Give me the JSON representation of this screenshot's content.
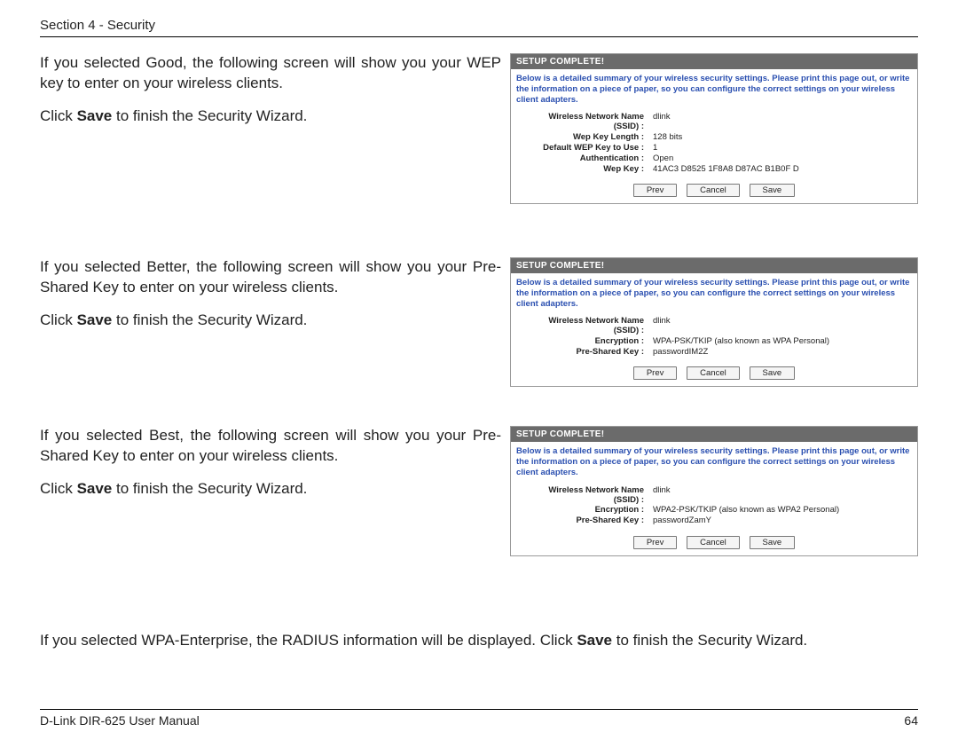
{
  "header": {
    "section_label": "Section 4 - Security"
  },
  "footer": {
    "left": "D-Link DIR-625 User Manual",
    "page": "64"
  },
  "panel_common": {
    "title": "SETUP COMPLETE!",
    "desc": "Below is a detailed summary of your wireless security settings. Please print this page out, or write the information on a piece of paper, so you can configure the correct settings on your wireless client adapters.",
    "btn_prev": "Prev",
    "btn_cancel": "Cancel",
    "btn_save": "Save"
  },
  "good": {
    "p1": "If you selected Good, the following screen will show you your WEP key to enter on your wireless clients.",
    "p2a": "Click ",
    "p2b": "Save",
    "p2c": " to finish the Security Wizard.",
    "fields": {
      "ssid_label": "Wireless Network Name\n(SSID) :",
      "ssid_val": "dlink",
      "len_label": "Wep Key Length :",
      "len_val": "128 bits",
      "idx_label": "Default WEP Key to Use :",
      "idx_val": "1",
      "auth_label": "Authentication :",
      "auth_val": "Open",
      "key_label": "Wep Key :",
      "key_val": "41AC3 D8525 1F8A8 D87AC B1B0F D"
    }
  },
  "better": {
    "p1": "If you selected Better, the following screen will show you your Pre-Shared Key to enter on your wireless clients.",
    "p2a": "Click ",
    "p2b": "Save",
    "p2c": " to finish the Security Wizard.",
    "fields": {
      "ssid_label": "Wireless Network Name\n(SSID) :",
      "ssid_val": "dlink",
      "enc_label": "Encryption :",
      "enc_val": "WPA-PSK/TKIP (also known as WPA Personal)",
      "psk_label": "Pre-Shared Key :",
      "psk_val": "passwordIM2Z"
    }
  },
  "best": {
    "p1": "If you selected Best, the following screen will show you your Pre-Shared Key to enter on your wireless clients.",
    "p2a": "Click ",
    "p2b": "Save",
    "p2c": " to finish the Security Wizard.",
    "fields": {
      "ssid_label": "Wireless Network Name\n(SSID) :",
      "ssid_val": "dlink",
      "enc_label": "Encryption :",
      "enc_val": "WPA2-PSK/TKIP (also known as WPA2 Personal)",
      "psk_label": "Pre-Shared Key :",
      "psk_val": "passwordZamY"
    }
  },
  "wpa_ent": {
    "a": "If you selected WPA-Enterprise, the RADIUS information will be displayed. Click ",
    "b": "Save",
    "c": " to finish the Security Wizard."
  }
}
